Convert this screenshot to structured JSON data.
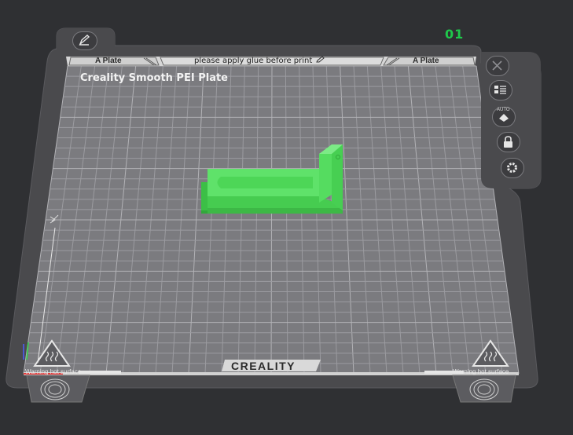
{
  "plate": {
    "number": "01",
    "name": "Creality Smooth PEI Plate",
    "left_tab": "A Plate",
    "right_tab": "A Plate",
    "center_note": "please apply glue before print",
    "brand": "CREALITY",
    "warning_left": "Warning hot surface",
    "warning_right": "Warning hot surface"
  },
  "toolbar": {
    "auto_label": "AUTO",
    "buttons": [
      "close-icon",
      "arrange-list-icon",
      "auto-orient-icon",
      "lock-icon",
      "gear-icon"
    ]
  },
  "icons": {
    "edit": "pencil-icon",
    "hot_surface": "hot-surface-warning-icon",
    "fingerprint": "fingerprint-icon"
  },
  "colors": {
    "background": "#2f3033",
    "plate_frame": "#4a4a4d",
    "bed_grid": "#7a7a7e",
    "grid_line": "#9c9ca0",
    "model": "#4ed85a",
    "plate_number": "#1fc94b"
  }
}
